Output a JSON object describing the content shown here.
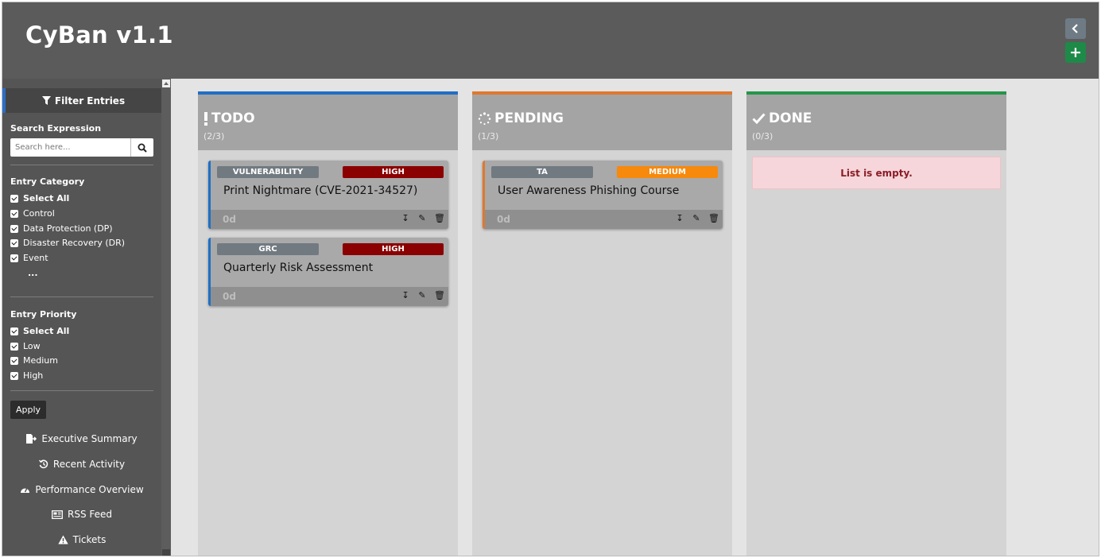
{
  "app": {
    "title": "CyBan v1.1"
  },
  "header": {
    "collapse_icon": "chevron-left-icon",
    "add_icon": "plus-icon"
  },
  "sidebar": {
    "filter_title": "Filter Entries",
    "search": {
      "title": "Search Expression",
      "placeholder": "Search here...",
      "value": ""
    },
    "category": {
      "title": "Entry Category",
      "items": [
        "Select All",
        "Control",
        "Data Protection (DP)",
        "Disaster Recovery (DR)",
        "Event"
      ],
      "more": "..."
    },
    "priority": {
      "title": "Entry Priority",
      "items": [
        "Select All",
        "Low",
        "Medium",
        "High"
      ]
    },
    "apply_label": "Apply",
    "links": [
      {
        "label": "Executive Summary",
        "icon": "export-file-icon"
      },
      {
        "label": "Recent Activity",
        "icon": "history-icon"
      },
      {
        "label": "Performance Overview",
        "icon": "gauge-icon"
      },
      {
        "label": "RSS Feed",
        "icon": "newspaper-icon"
      },
      {
        "label": "Tickets",
        "icon": "warning-icon"
      }
    ]
  },
  "columns": [
    {
      "title": "TODO",
      "count": "(2/3)",
      "icon": "exclamation-icon",
      "color": "#1f6fc5",
      "cards": [
        {
          "category": "VULNERABILITY",
          "priority": "HIGH",
          "priority_color": "#8b0000",
          "title": "Print Nightmare (CVE-2021-34527)",
          "age": "0d"
        },
        {
          "category": "GRC",
          "priority": "HIGH",
          "priority_color": "#8b0000",
          "title": "Quarterly Risk Assessment",
          "age": "0d"
        }
      ]
    },
    {
      "title": "PENDING",
      "count": "(1/3)",
      "icon": "spinner-icon",
      "color": "#e0782d",
      "cards": [
        {
          "category": "TA",
          "priority": "MEDIUM",
          "priority_color": "#f7890c",
          "title": "User Awareness Phishing Course",
          "age": "0d"
        }
      ]
    },
    {
      "title": "DONE",
      "count": "(0/3)",
      "icon": "check-icon",
      "color": "#23964a",
      "cards": [],
      "empty_text": "List is empty."
    }
  ]
}
